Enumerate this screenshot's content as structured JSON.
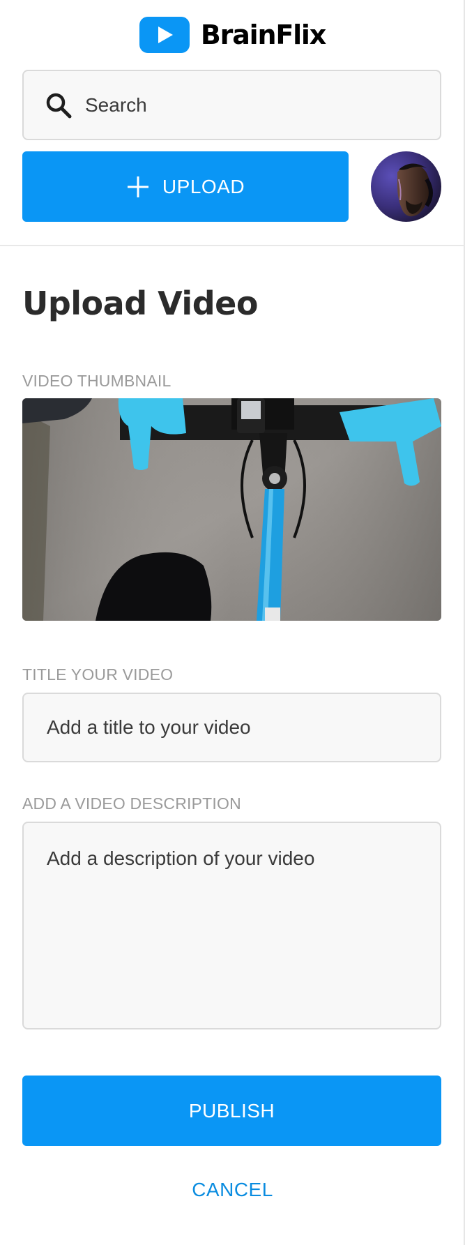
{
  "brand": {
    "name": "BrainFlix",
    "icon": "play-icon",
    "color": "#0a96f5"
  },
  "search": {
    "placeholder": "Search",
    "value": "",
    "icon": "search-icon"
  },
  "header": {
    "upload_label": "UPLOAD",
    "upload_icon": "plus-icon",
    "avatar": "user-avatar"
  },
  "main": {
    "title": "Upload Video",
    "thumbnail_label": "VIDEO THUMBNAIL",
    "thumbnail_image": "bicycle-handlebars-photo",
    "title_label": "TITLE YOUR VIDEO",
    "title_placeholder": "Add a title to your video",
    "description_label": "ADD A VIDEO DESCRIPTION",
    "description_placeholder": "Add a description of your video"
  },
  "actions": {
    "publish_label": "PUBLISH",
    "cancel_label": "CANCEL"
  },
  "colors": {
    "accent": "#0a96f5",
    "link": "#0a8ce0",
    "muted_label": "#9a9a9a",
    "field_bg": "#f8f8f8",
    "field_border": "#dadada"
  }
}
